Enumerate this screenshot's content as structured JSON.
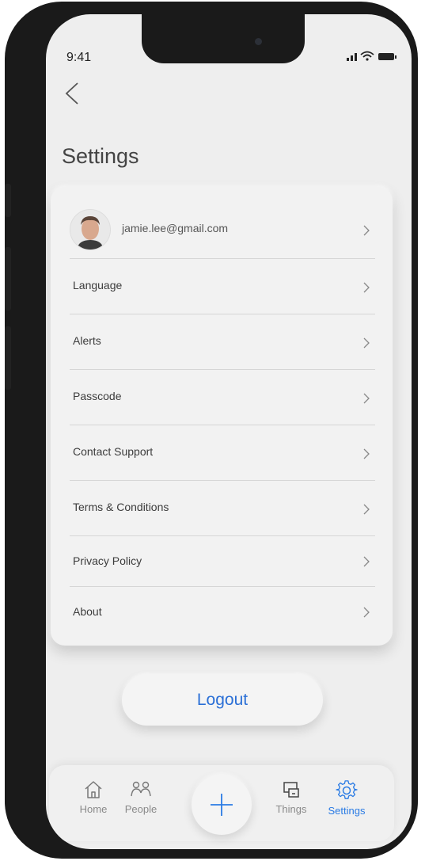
{
  "status_bar": {
    "time": "9:41"
  },
  "page": {
    "title": "Settings"
  },
  "settings": {
    "account_email": "jamie.lee@gmail.com",
    "items": [
      {
        "label": "Language"
      },
      {
        "label": "Alerts"
      },
      {
        "label": "Passcode"
      },
      {
        "label": "Contact Support"
      },
      {
        "label": "Terms & Conditions"
      },
      {
        "label": "Privacy Policy"
      },
      {
        "label": "About"
      }
    ]
  },
  "logout": {
    "label": "Logout"
  },
  "tabbar": {
    "tabs": [
      {
        "label": "Home",
        "icon": "home-icon"
      },
      {
        "label": "People",
        "icon": "people-icon"
      },
      {
        "label": "Things",
        "icon": "devices-icon"
      },
      {
        "label": "Settings",
        "icon": "gear-icon"
      }
    ],
    "active_tab": "Settings",
    "add_icon": "plus-icon"
  },
  "colors": {
    "accent": "#2a7be4",
    "logout_text": "#2a6fd6",
    "background": "#eeeeee"
  }
}
